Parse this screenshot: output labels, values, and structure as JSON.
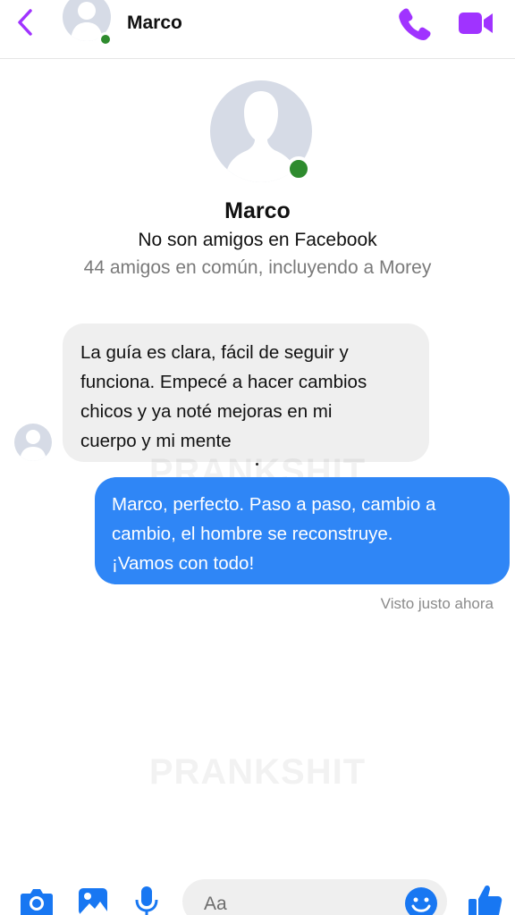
{
  "header": {
    "contact_name": "Marco"
  },
  "profile": {
    "name": "Marco",
    "relationship": "No son amigos en Facebook",
    "mutual_friends": "44 amigos en común, incluyendo a Morey"
  },
  "messages": [
    {
      "direction": "incoming",
      "lines": [
        "La guía es clara, fácil de seguir y",
        "funciona. Empecé a hacer cambios",
        "chicos y ya noté mejoras en mi",
        "cuerpo y mi mente"
      ]
    },
    {
      "direction": "outgoing",
      "lines": [
        "Marco, perfecto. Paso a paso, cambio a",
        "cambio, el hombre se reconstruye.",
        "¡Vamos con todo!"
      ]
    }
  ],
  "seen_status": "Visto justo ahora",
  "watermark": "PRANKSHIT",
  "composer": {
    "placeholder": "Aa"
  },
  "colors": {
    "accent_purple": "#a033ff",
    "bubble_out": "#2f86f6",
    "bubble_in": "#efefef",
    "online_green": "#2e8b2e",
    "composer_blue": "#1877f2"
  },
  "icons": {
    "back": "chevron-left-icon",
    "call": "phone-icon",
    "video": "video-camera-icon",
    "camera": "camera-icon",
    "gallery": "image-icon",
    "mic": "microphone-icon",
    "emoji": "emoji-icon",
    "like": "thumbs-up-icon"
  }
}
